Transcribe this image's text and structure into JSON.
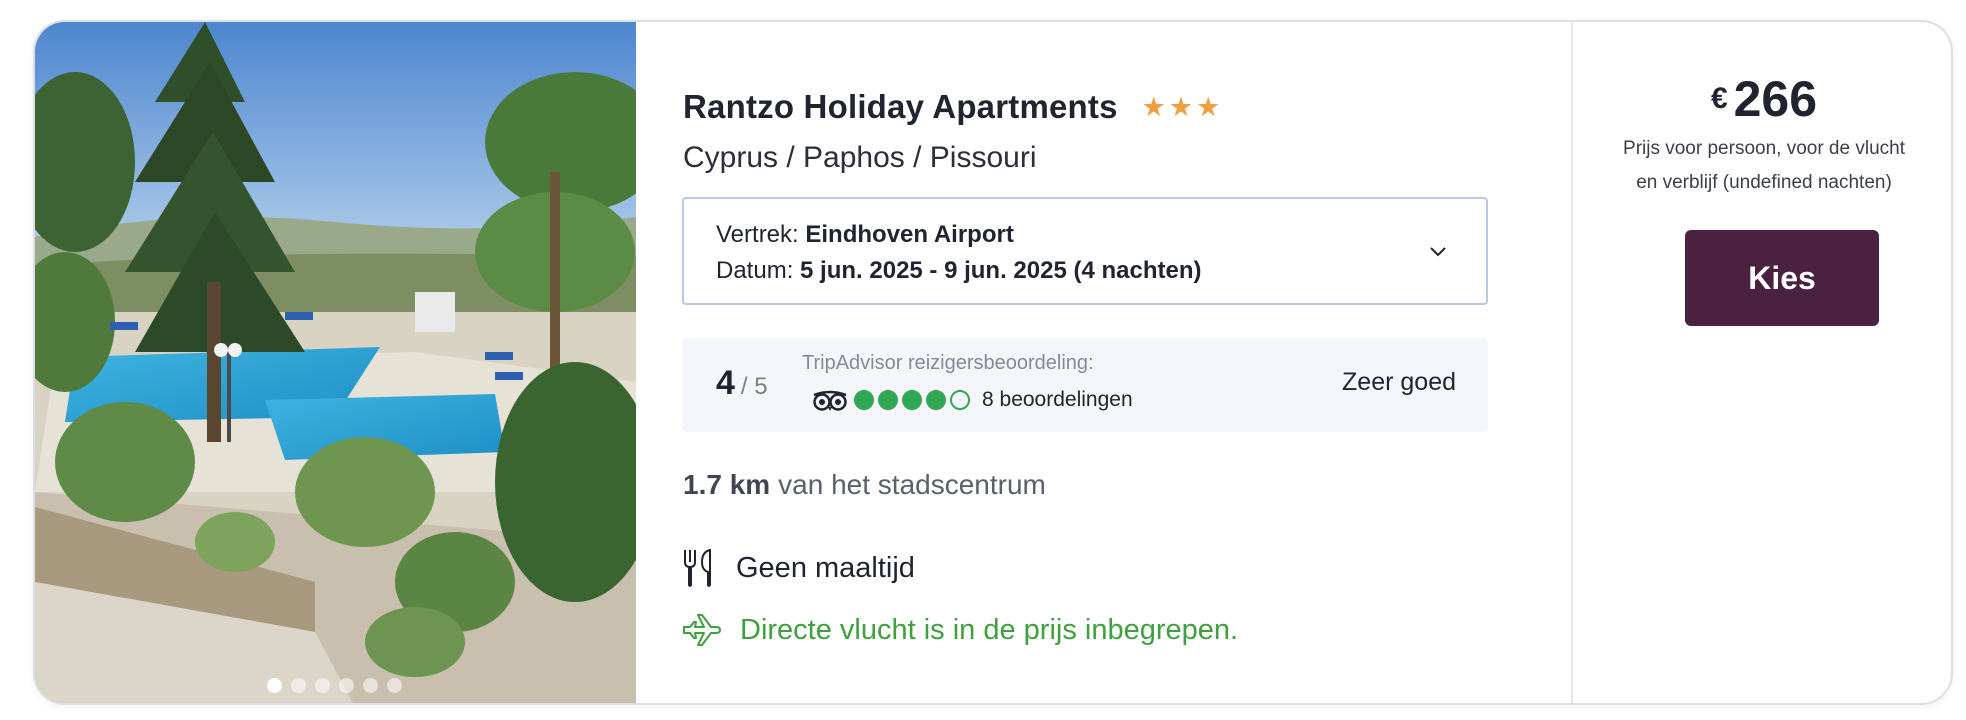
{
  "hotel": {
    "name": "Rantzo Holiday Apartments",
    "stars": 3,
    "location": "Cyprus / Paphos / Pissouri"
  },
  "flight": {
    "departure_label": "Vertrek:",
    "departure_value": "Eindhoven Airport",
    "date_label": "Datum:",
    "date_value": "5 jun. 2025 - 9 jun. 2025 (4 nachten)"
  },
  "rating": {
    "score": "4",
    "max": "/ 5",
    "source_label": "TripAdvisor reizigersbeoordeling:",
    "bubbles_filled": 4,
    "bubbles_total": 5,
    "reviews": "8 beoordelingen",
    "verdict": "Zeer goed"
  },
  "distance": {
    "value": "1.7 km",
    "label": "van het stadscentrum"
  },
  "meal": "Geen maaltijd",
  "flight_included": "Directe vlucht is in de prijs inbegrepen.",
  "price": {
    "currency": "€",
    "amount": "266",
    "note": "Prijs voor persoon, voor de vlucht en verblijf (undefined nachten)"
  },
  "cta": {
    "label": "Kies"
  },
  "gallery": {
    "count": 6,
    "active": 0
  },
  "colors": {
    "brand": "#4a2141",
    "star": "#f0a040",
    "tripadvisor_green": "#34a853",
    "included_green": "#3ea03e"
  }
}
